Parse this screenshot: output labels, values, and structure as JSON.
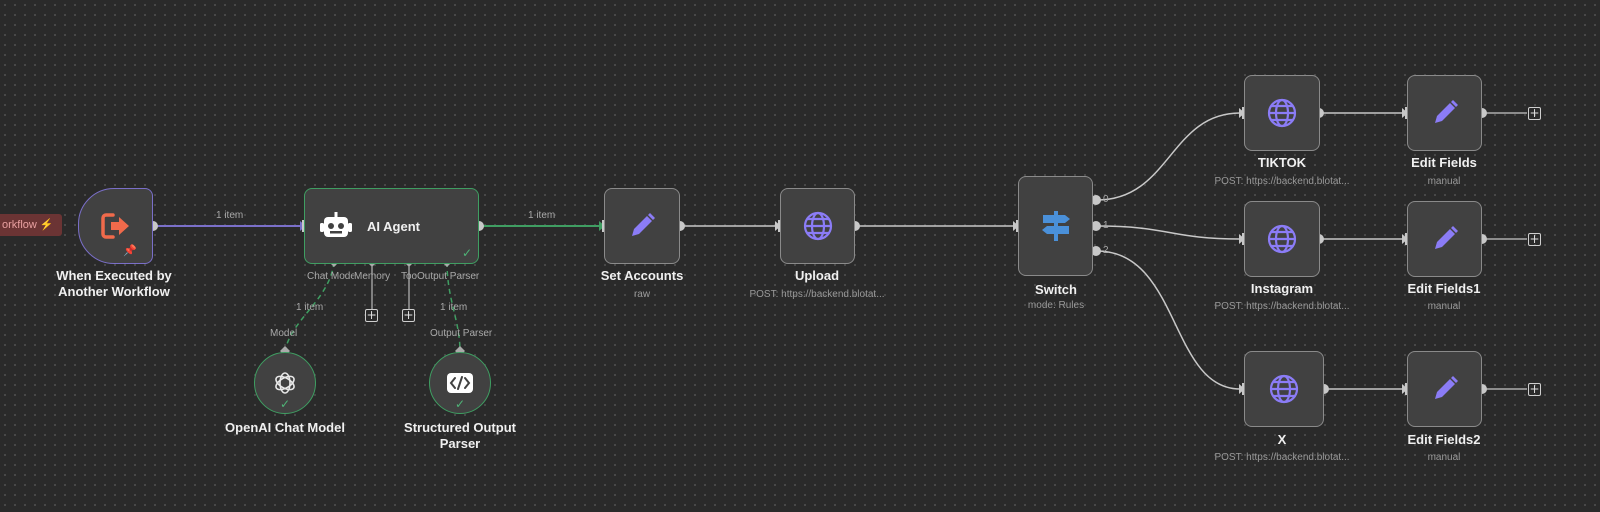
{
  "workflow_tag": "orkflow",
  "colors": {
    "accent_green": "#3f9e62",
    "trigger_purple": "#7a6fc9",
    "icon_blue": "#8b7cf6",
    "switch_blue": "#4a90d9"
  },
  "nodes": {
    "trigger": {
      "title": "When Executed by Another Workflow",
      "icon": "sign-out-arrow-icon"
    },
    "agent": {
      "title": "AI Agent",
      "icon": "robot-icon",
      "ports": {
        "chat_model": "Chat Model",
        "memory": "Memory",
        "tool": "Tool",
        "output_parser": "Output Parser"
      }
    },
    "openai": {
      "title": "OpenAI Chat Model",
      "port_label": "Model",
      "icon": "openai-icon"
    },
    "parser": {
      "title": "Structured Output Parser",
      "port_label": "Output Parser",
      "icon": "code-brackets-icon"
    },
    "set_accounts": {
      "title": "Set Accounts",
      "subtitle": "raw",
      "icon": "pencil-icon"
    },
    "upload": {
      "title": "Upload",
      "subtitle": "POST: https://backend.blotat...",
      "icon": "globe-icon"
    },
    "switch": {
      "title": "Switch",
      "subtitle": "mode: Rules",
      "outputs": [
        "0",
        "1",
        "2"
      ],
      "icon": "signpost-icon"
    },
    "tiktok": {
      "title": "TIKTOK",
      "subtitle": "POST: https://backend.blotat...",
      "icon": "globe-icon"
    },
    "instagram": {
      "title": "Instagram",
      "subtitle": "POST: https://backend.blotat...",
      "icon": "globe-icon"
    },
    "x": {
      "title": "X",
      "subtitle": "POST: https://backend.blotat...",
      "icon": "globe-icon"
    },
    "edit_fields": {
      "title": "Edit Fields",
      "subtitle": "manual",
      "icon": "pencil-icon"
    },
    "edit_fields1": {
      "title": "Edit Fields1",
      "subtitle": "manual",
      "icon": "pencil-icon"
    },
    "edit_fields2": {
      "title": "Edit Fields2",
      "subtitle": "manual",
      "icon": "pencil-icon"
    }
  },
  "edge_labels": {
    "trigger_to_agent": "1 item",
    "agent_to_set": "1 item",
    "model_link": "1 item",
    "parser_link": "1 item"
  }
}
